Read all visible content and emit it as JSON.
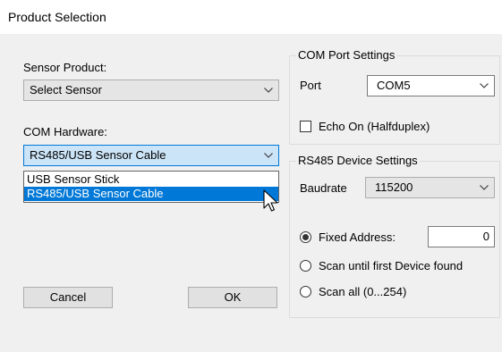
{
  "window": {
    "title": "Product Selection"
  },
  "sensor_product": {
    "label": "Sensor Product:",
    "selected": "Select Sensor"
  },
  "com_hardware": {
    "label": "COM Hardware:",
    "selected": "RS485/USB Sensor Cable",
    "options": [
      "USB Sensor Stick",
      "RS485/USB Sensor Cable"
    ]
  },
  "com_port_settings": {
    "title": "COM Port Settings",
    "port_label": "Port",
    "port_value": "COM5",
    "echo_label": "Echo On (Halfduplex)",
    "echo_checked": false
  },
  "rs485_settings": {
    "title": "RS485 Device Settings",
    "baudrate_label": "Baudrate",
    "baudrate_value": "115200",
    "fixed_address_label": "Fixed Address:",
    "fixed_address_value": "0",
    "scan_first_label": "Scan until first Device found",
    "scan_all_label": "Scan all (0...254)",
    "selected_mode": "fixed_address"
  },
  "buttons": {
    "cancel": "Cancel",
    "ok": "OK"
  },
  "icons": {
    "dropdown_arrow": "chevron-down-icon",
    "cursor": "mouse-pointer-icon"
  },
  "colors": {
    "window_bg": "#f0f0f0",
    "selection": "#0078d7",
    "focus_bg": "#cce4f7"
  }
}
